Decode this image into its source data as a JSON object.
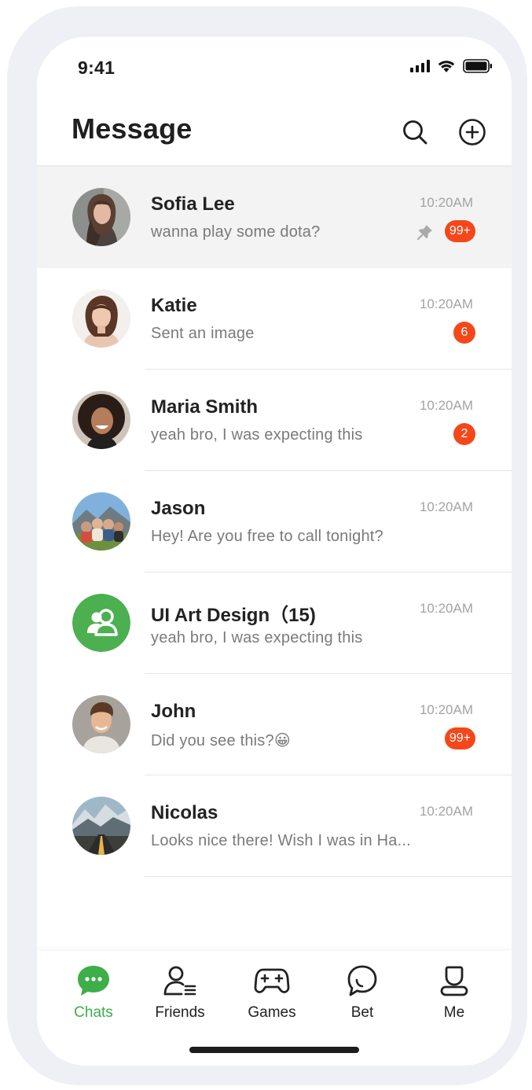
{
  "status_bar": {
    "time": "9:41"
  },
  "header": {
    "title": "Message"
  },
  "chats": [
    {
      "name": "Sofia Lee",
      "preview": "wanna play some dota?",
      "time": "10:20AM",
      "badge": "99+",
      "pinned": true,
      "avatar": "portrait-photo"
    },
    {
      "name": "Katie",
      "preview": "Sent an image",
      "time": "10:20AM",
      "badge": "6",
      "pinned": false,
      "avatar": "portrait-photo"
    },
    {
      "name": "Maria Smith",
      "preview": "yeah bro, I was expecting this",
      "time": "10:20AM",
      "badge": "2",
      "pinned": false,
      "avatar": "portrait-photo"
    },
    {
      "name": "Jason",
      "preview": "Hey! Are you free to call tonight?",
      "time": "10:20AM",
      "badge": "",
      "pinned": false,
      "avatar": "group-photo"
    },
    {
      "name": "UI Art Design（15)",
      "preview": "yeah bro, I was expecting this",
      "time": "10:20AM",
      "badge": "",
      "pinned": false,
      "avatar": "group-icon"
    },
    {
      "name": "John",
      "preview": "Did you see this?😀",
      "time": "10:20AM",
      "badge": "99+",
      "pinned": false,
      "avatar": "portrait-photo"
    },
    {
      "name": "Nicolas",
      "preview": "Looks nice there! Wish I was in Ha...",
      "time": "10:20AM",
      "badge": "",
      "pinned": false,
      "avatar": "landscape-photo"
    }
  ],
  "tabs": [
    {
      "label": "Chats",
      "icon": "chat-bubble-icon",
      "active": true
    },
    {
      "label": "Friends",
      "icon": "friends-icon",
      "active": false
    },
    {
      "label": "Games",
      "icon": "gamepad-icon",
      "active": false
    },
    {
      "label": "Bet",
      "icon": "bet-icon",
      "active": false
    },
    {
      "label": "Me",
      "icon": "profile-icon",
      "active": false
    }
  ],
  "colors": {
    "accent_green": "#3dae4a",
    "badge_red": "#f5471a",
    "pinned_row_bg": "#f3f3f3",
    "frame_bg": "#eef0f5"
  }
}
